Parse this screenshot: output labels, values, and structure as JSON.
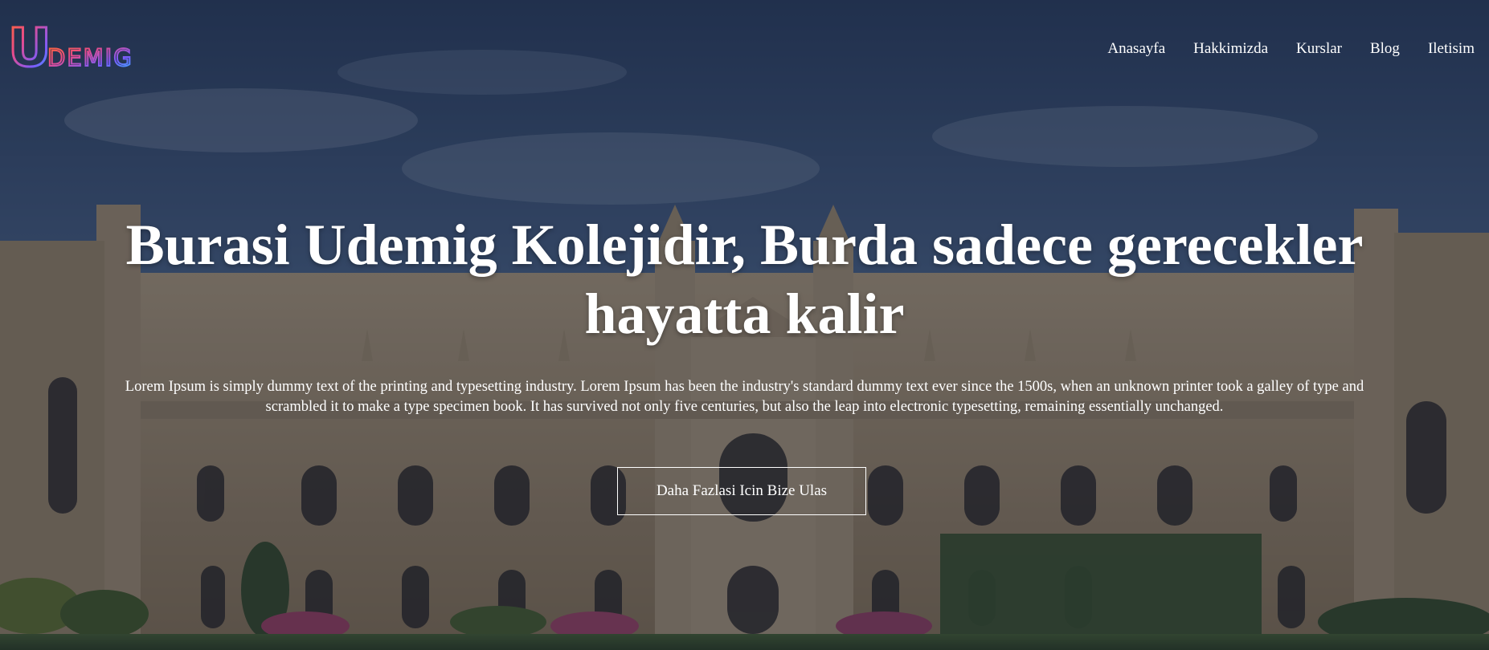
{
  "brand": {
    "logo_letter": "U",
    "logo_rest": "DEMIG",
    "logo_colors": [
      "#ff6a2b",
      "#e94b8a",
      "#7a5cff",
      "#2fb6ff"
    ]
  },
  "nav": {
    "items": [
      {
        "label": "Anasayfa"
      },
      {
        "label": "Hakkimizda"
      },
      {
        "label": "Kurslar"
      },
      {
        "label": "Blog"
      },
      {
        "label": "Iletisim"
      }
    ]
  },
  "hero": {
    "title_line1": "Burasi Udemig Kolejidir, Burda sadece gerecekler",
    "title_line2": "hayatta kalir",
    "description": "Lorem Ipsum is simply dummy text of the printing and typesetting industry. Lorem Ipsum has been the industry's standard dummy text ever since the 1500s, when an unknown printer took a galley of type and scrambled it to make a type specimen book. It has survived not only five centuries, but also the leap into electronic typesetting, remaining essentially unchanged.",
    "cta_label": "Daha Fazlasi Icin Bize Ulas"
  },
  "colors": {
    "overlay": "#141c30",
    "sky": "#3b5478",
    "stone": "#b59f7c",
    "text": "#ffffff"
  }
}
